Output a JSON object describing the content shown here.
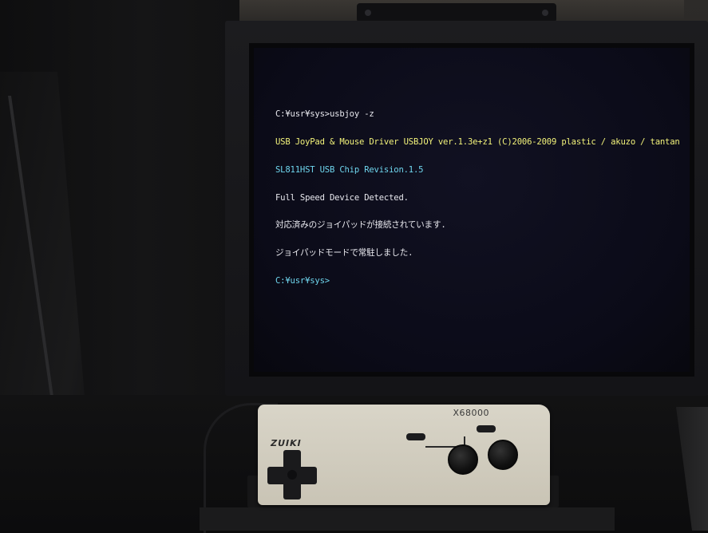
{
  "terminal": {
    "lines": [
      {
        "text": "C:¥usr¥sys>usbjoy -z",
        "color": "white-prompt"
      },
      {
        "text": "USB JoyPad & Mouse Driver USBJOY ver.1.3e+z1 (C)2006-2009 plastic / akuzo / tantan",
        "color": "yellow"
      },
      {
        "text": "SL811HST USB Chip Revision.1.5",
        "color": "cyan"
      },
      {
        "text": "Full Speed Device Detected.",
        "color": "white"
      },
      {
        "text": "対応済みのジョイパッドが接続されています.",
        "color": "white"
      },
      {
        "text": "ジョイパッドモードで常駐しました.",
        "color": "white"
      },
      {
        "text": "C:¥usr¥sys>",
        "color": "cyan"
      }
    ],
    "prompt": "C:¥usr¥sys>",
    "command": "usbjoy -z"
  },
  "gamepad": {
    "brand_left": "ZUIKI",
    "brand_right": "X68000"
  },
  "colors": {
    "terminal_white": "#e8e8ee",
    "terminal_yellow": "#f2f27a",
    "terminal_cyan": "#6fd6ee",
    "screen_bg": "#0b0b18"
  }
}
